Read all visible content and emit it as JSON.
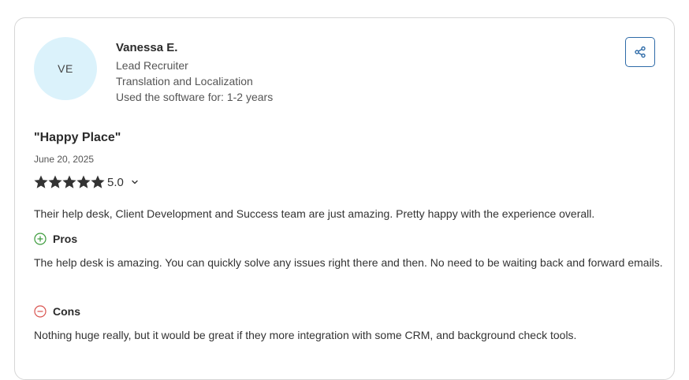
{
  "reviewer": {
    "initials": "VE",
    "name": "Vanessa E.",
    "role": "Lead Recruiter",
    "industry": "Translation and Localization",
    "usage": "Used the software for: 1-2 years"
  },
  "share": {
    "icon": "share-icon"
  },
  "review": {
    "title": "\"Happy Place\"",
    "date": "June 20, 2025",
    "rating": 5,
    "rating_label": "5.0",
    "summary": "Their help desk, Client Development and Success team are just amazing. Pretty happy with the experience overall."
  },
  "pros": {
    "label": "Pros",
    "icon": "plus-circle-icon",
    "color": "#3a9a3a",
    "text": "The help desk is amazing. You can quickly solve any issues right there and then. No need to be waiting back and forward emails."
  },
  "cons": {
    "label": "Cons",
    "icon": "minus-circle-icon",
    "color": "#d9534f",
    "text": "Nothing huge really, but it would be great if they more integration with some CRM, and background check tools."
  },
  "colors": {
    "avatar_bg": "#dbf2fb",
    "accent": "#2e6ba8",
    "star": "#333333"
  }
}
